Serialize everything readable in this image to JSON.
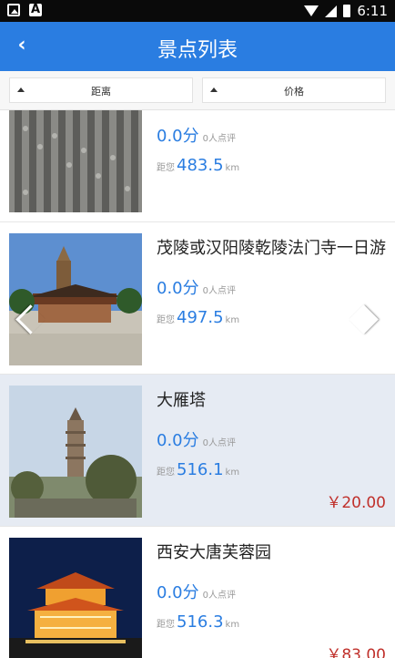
{
  "status_bar": {
    "time": "6:11"
  },
  "app_bar": {
    "title": "景点列表",
    "back_icon": "chevron-left-icon"
  },
  "filters": {
    "distance_label": "距离",
    "price_label": "价格"
  },
  "spots": [
    {
      "name": "",
      "score": "0.0分",
      "review_text": "0人点评",
      "distance_prefix": "距您",
      "distance": "483.5",
      "distance_unit": "km",
      "price": ""
    },
    {
      "name": "茂陵或汉阳陵乾陵法门寺一日游",
      "score": "0.0分",
      "review_text": "0人点评",
      "distance_prefix": "距您",
      "distance": "497.5",
      "distance_unit": "km",
      "price": ""
    },
    {
      "name": "大雁塔",
      "score": "0.0分",
      "review_text": "0人点评",
      "distance_prefix": "距您",
      "distance": "516.1",
      "distance_unit": "km",
      "price": "￥20.00"
    },
    {
      "name": "西安大唐芙蓉园",
      "score": "0.0分",
      "review_text": "0人点评",
      "distance_prefix": "距您",
      "distance": "516.3",
      "distance_unit": "km",
      "price": "￥83.00"
    }
  ],
  "colors": {
    "app_bar": "#2a7de1",
    "accent": "#2a7de1",
    "price": "#c0302b",
    "highlight_row": "#e6ebf3"
  }
}
